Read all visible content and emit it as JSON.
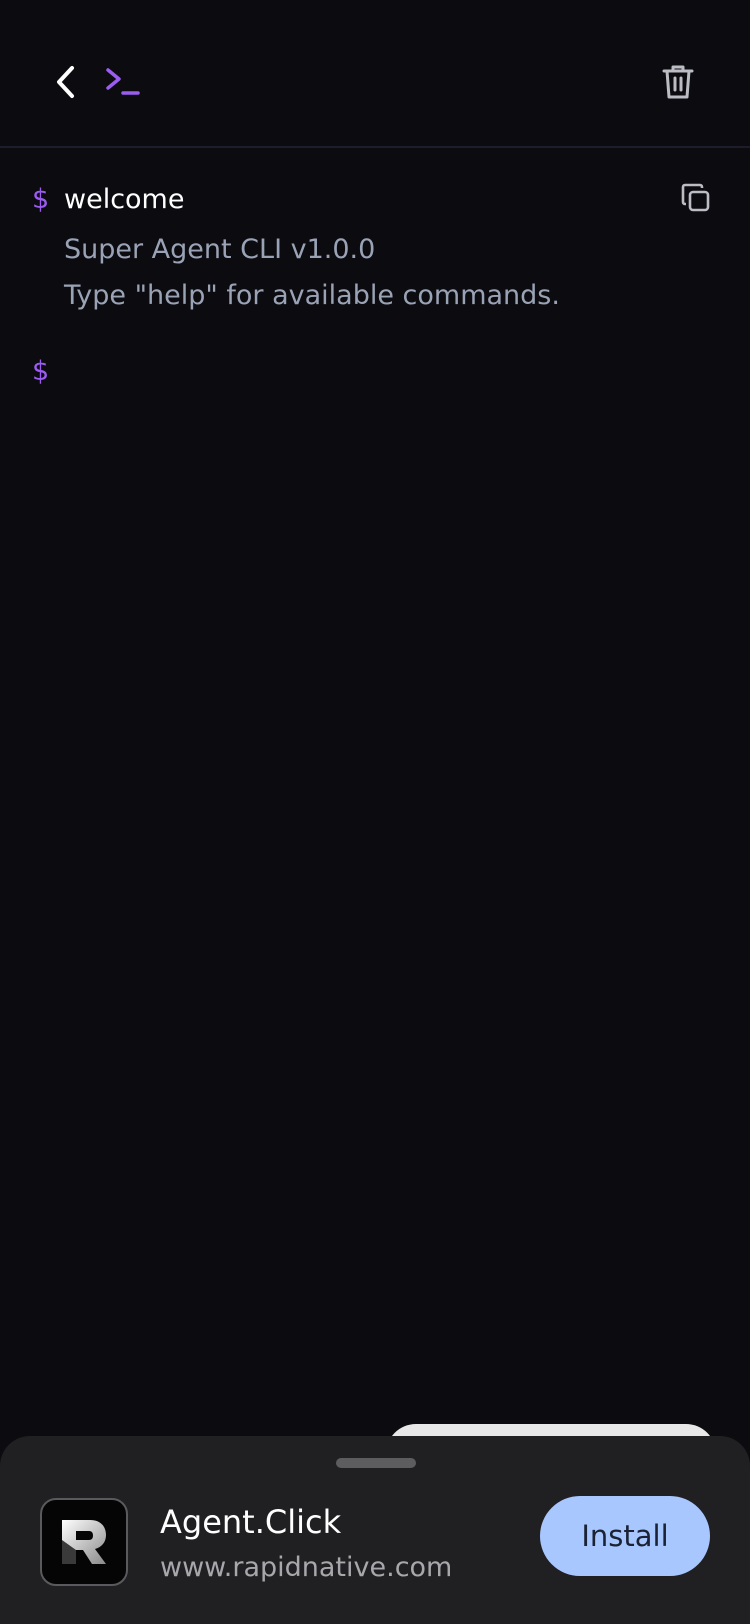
{
  "header": {
    "back_icon": "chevron-left-icon",
    "terminal_icon": "terminal-icon",
    "trash_icon": "trash-icon"
  },
  "terminal": {
    "prompt_symbol": "$",
    "command": "welcome",
    "output_lines": [
      "Super Agent CLI v1.0.0",
      "Type \"help\" for available commands."
    ],
    "copy_icon": "copy-icon"
  },
  "install_sheet": {
    "app_name": "Agent.Click",
    "app_url": "www.rapidnative.com",
    "install_label": "Install"
  },
  "colors": {
    "background": "#0b0b10",
    "accent": "#9b5cf0",
    "output_text": "#9aa3b5",
    "install_button": "#a9c7ff",
    "sheet_background": "#202022"
  }
}
